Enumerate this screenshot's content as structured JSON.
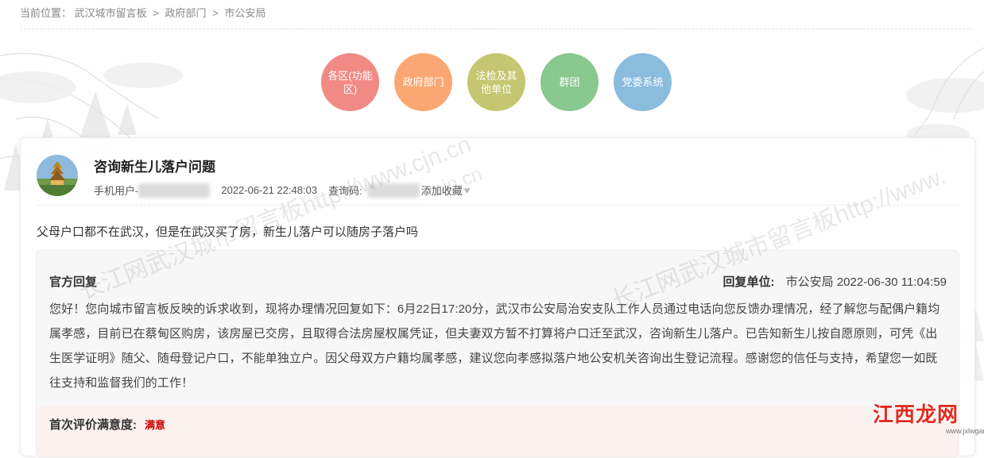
{
  "breadcrumb": {
    "prefix": "当前位置：",
    "items": [
      "武汉城市留言板",
      "政府部门",
      "市公安局"
    ],
    "separator": ">"
  },
  "categories": [
    {
      "label": "各区(功能区)",
      "color": "#f18985"
    },
    {
      "label": "政府部门",
      "color": "#fba774"
    },
    {
      "label": "法检及其他单位",
      "color": "#c4c76f"
    },
    {
      "label": "群团",
      "color": "#89c88e"
    },
    {
      "label": "党委系统",
      "color": "#8abcde"
    }
  ],
  "message": {
    "title": "咨询新生儿落户问题",
    "user_prefix": "手机用户-",
    "time": "2022-06-21 22:48:03",
    "code_label": "查询码:",
    "favorite_label": "添加收藏",
    "content": "父母户口都不在武汉，但是在武汉买了房，新生儿落户可以随房子落户吗"
  },
  "reply": {
    "title": "官方回复",
    "unit_label": "回复单位:",
    "unit": "市公安局",
    "time": "2022-06-30 11:04:59",
    "text": "您好！您向城市留言板反映的诉求收到，现将办理情况回复如下：6月22日17:20分，武汉市公安局治安支队工作人员通过电话向您反馈办理情况，经了解您与配偶户籍均属孝感，目前已在蔡甸区购房，该房屋已交房，且取得合法房屋权属凭证，但夫妻双方暂不打算将户口迁至武汉，咨询新生儿落户。已告知新生儿按自愿原则，可凭《出生医学证明》随父、随母登记户口，不能单独立户。因父母双方户籍均属孝感，建议您向孝感拟落户地公安机关咨询出生登记流程。感谢您的信任与支持，希望您一如既往支持和监督我们的工作！"
  },
  "evaluation": {
    "label": "首次评价满意度:",
    "value": "满意"
  },
  "watermarks": {
    "main": "长江网武汉城市留言板http://www.cjn.cn",
    "right": "长江网武汉城市留言板http://www.",
    "small": "sjn.cn"
  },
  "logo": {
    "text": "江西龙网",
    "url": "www.jxlwgame.com"
  }
}
